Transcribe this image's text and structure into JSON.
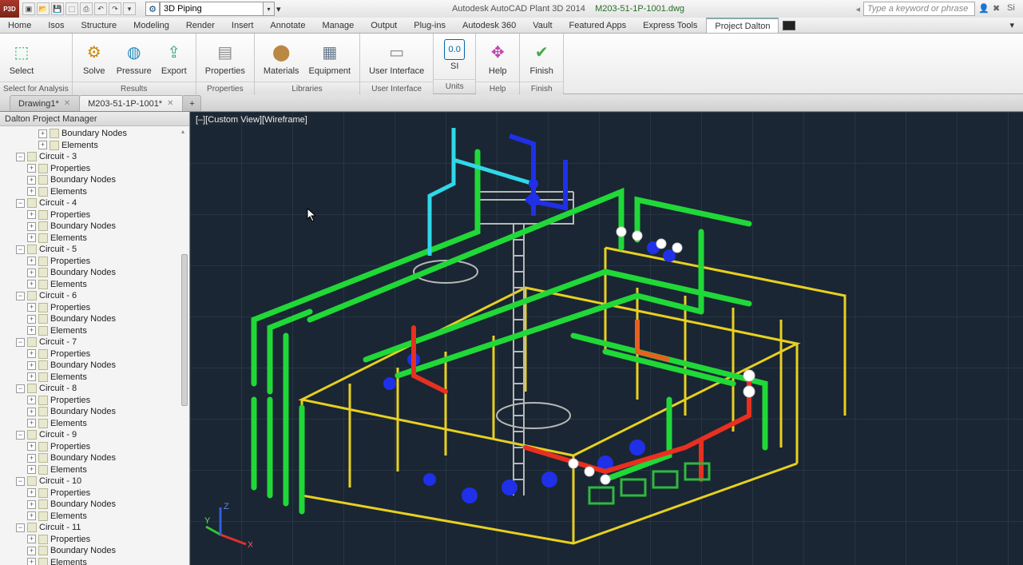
{
  "app": {
    "title": "Autodesk AutoCAD Plant 3D 2014",
    "document": "M203-51-1P-1001.dwg",
    "search_placeholder": "Type a keyword or phrase",
    "workspace": "3D Piping"
  },
  "qat_icons": [
    "new",
    "open",
    "save",
    "saveall",
    "print",
    "undo",
    "redo"
  ],
  "tabs": [
    "Home",
    "Isos",
    "Structure",
    "Modeling",
    "Render",
    "Insert",
    "Annotate",
    "Manage",
    "Output",
    "Plug-ins",
    "Autodesk 360",
    "Vault",
    "Featured Apps",
    "Express Tools",
    "Project Dalton"
  ],
  "active_tab": "Project Dalton",
  "ribbon": [
    {
      "label": "Select for Analysis",
      "items": [
        {
          "name": "select",
          "label": "Select",
          "icon": "⬚",
          "color": "#2b7"
        }
      ]
    },
    {
      "label": "Results",
      "items": [
        {
          "name": "solve",
          "label": "Solve",
          "icon": "⚙",
          "color": "#c80"
        },
        {
          "name": "pressure",
          "label": "Pressure",
          "icon": "◍",
          "color": "#28b"
        },
        {
          "name": "export",
          "label": "Export",
          "icon": "⇪",
          "color": "#3a7"
        }
      ]
    },
    {
      "label": "Properties",
      "items": [
        {
          "name": "properties",
          "label": "Properties",
          "icon": "▤",
          "color": "#888"
        }
      ]
    },
    {
      "label": "Libraries",
      "items": [
        {
          "name": "materials",
          "label": "Materials",
          "icon": "⬤",
          "color": "#b84"
        },
        {
          "name": "equipment",
          "label": "Equipment",
          "icon": "▦",
          "color": "#678"
        }
      ]
    },
    {
      "label": "User Interface",
      "items": [
        {
          "name": "user-interface",
          "label": "User Interface",
          "icon": "▭",
          "color": "#888"
        }
      ]
    },
    {
      "label": "Units",
      "items": [
        {
          "name": "si",
          "label": "SI",
          "icon": "0.0",
          "color": "#06a",
          "small": true
        }
      ]
    },
    {
      "label": "Help",
      "items": [
        {
          "name": "help",
          "label": "Help",
          "icon": "✥",
          "color": "#b4a"
        }
      ]
    },
    {
      "label": "Finish",
      "items": [
        {
          "name": "finish",
          "label": "Finish",
          "icon": "✔",
          "color": "#4a4"
        }
      ]
    }
  ],
  "doc_tabs": [
    {
      "label": "Drawing1*",
      "active": false
    },
    {
      "label": "M203-51-1P-1001*",
      "active": true
    }
  ],
  "sidebar": {
    "title": "Dalton Project Manager",
    "top_orphans": [
      {
        "label": "Boundary Nodes",
        "indent": 3
      },
      {
        "label": "Elements",
        "indent": 3
      }
    ],
    "circuits": [
      {
        "name": "Circuit - 3",
        "children": [
          "Properties",
          "Boundary Nodes",
          "Elements"
        ]
      },
      {
        "name": "Circuit - 4",
        "children": [
          "Properties",
          "Boundary Nodes",
          "Elements"
        ]
      },
      {
        "name": "Circuit - 5",
        "children": [
          "Properties",
          "Boundary Nodes",
          "Elements"
        ]
      },
      {
        "name": "Circuit - 6",
        "children": [
          "Properties",
          "Boundary Nodes",
          "Elements"
        ]
      },
      {
        "name": "Circuit - 7",
        "children": [
          "Properties",
          "Boundary Nodes",
          "Elements"
        ]
      },
      {
        "name": "Circuit - 8",
        "children": [
          "Properties",
          "Boundary Nodes",
          "Elements"
        ]
      },
      {
        "name": "Circuit - 9",
        "children": [
          "Properties",
          "Boundary Nodes",
          "Elements"
        ]
      },
      {
        "name": "Circuit - 10",
        "children": [
          "Properties",
          "Boundary Nodes",
          "Elements"
        ]
      },
      {
        "name": "Circuit - 11",
        "children": [
          "Properties",
          "Boundary Nodes",
          "Elements"
        ]
      }
    ]
  },
  "viewport": {
    "controls": "[–][Custom View][Wireframe]",
    "axes": [
      "X",
      "Y",
      "Z"
    ]
  }
}
